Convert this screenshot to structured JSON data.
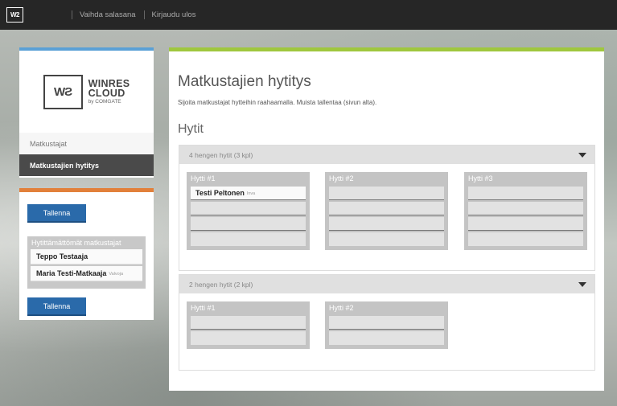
{
  "topbar": {
    "logo": "W2",
    "links": [
      "Vaihda salasana",
      "Kirjaudu ulos"
    ]
  },
  "brand": {
    "mark": "WƧ",
    "line1": "WINRES",
    "line2": "CLOUD",
    "line3": "by COMGATE"
  },
  "nav": {
    "items": [
      {
        "label": "Matkustajat",
        "active": false
      },
      {
        "label": "Matkustajien hytitys",
        "active": true
      }
    ]
  },
  "side": {
    "save_label": "Tallenna",
    "unassigned_title": "Hytittämättömät matkustajat",
    "unassigned": [
      {
        "name": "Teppo Testaaja",
        "tag": ""
      },
      {
        "name": "Maria Testi-Matkaaja",
        "tag": "Valvoja"
      }
    ]
  },
  "main": {
    "title": "Matkustajien hytitys",
    "subtitle": "Sijoita matkustajat hytteihin raahaamalla. Muista tallentaa (sivun alta).",
    "section": "Hytit",
    "groups": [
      {
        "header": "4 hengen hytit (3 kpl)",
        "cabins": [
          {
            "title": "Hytti #1",
            "occupant": "Testi Peltonen",
            "tag": "Inva"
          },
          {
            "title": "Hytti #2"
          },
          {
            "title": "Hytti #3"
          }
        ]
      },
      {
        "header": "2 hengen hytit (2 kpl)",
        "cabins": [
          {
            "title": "Hytti #1"
          },
          {
            "title": "Hytti #2"
          }
        ]
      }
    ]
  },
  "colors": {
    "topbar": "#262626",
    "accent_blue": "#5aa0d6",
    "accent_orange": "#e2803a",
    "accent_green": "#9fc73e",
    "button": "#2a6aaa"
  }
}
